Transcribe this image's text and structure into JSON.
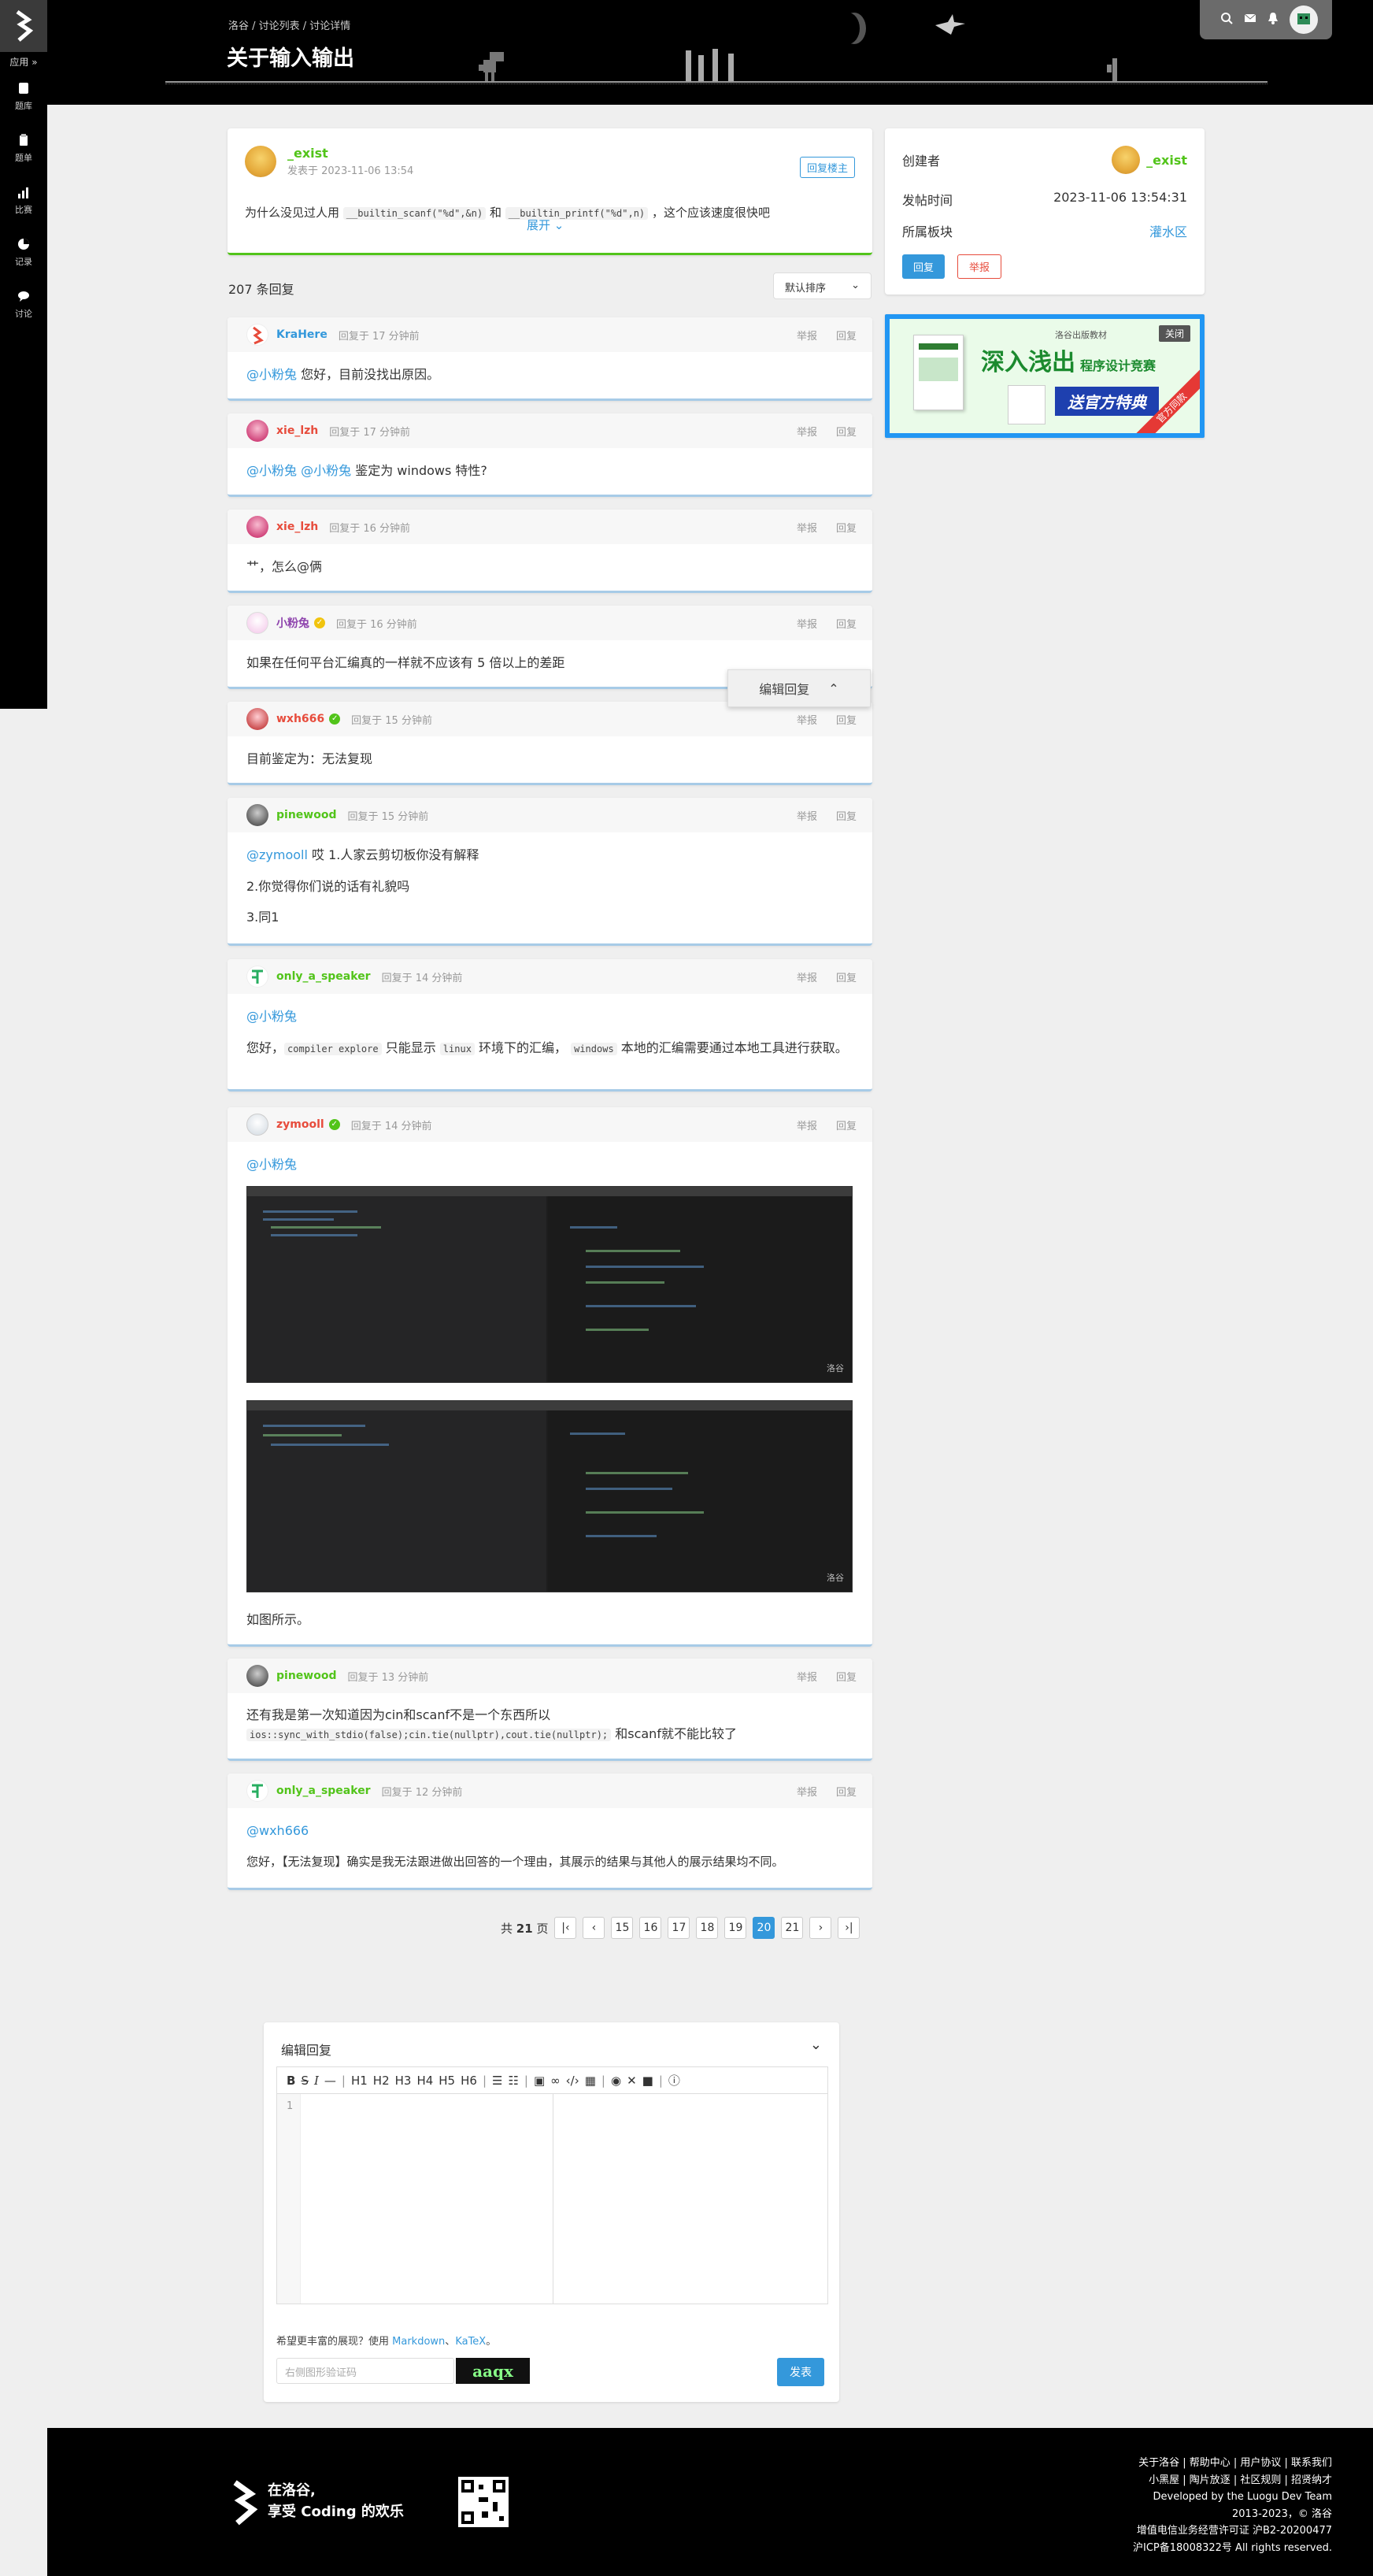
{
  "sidebar": {
    "apps_label": "应用 »",
    "nav": [
      {
        "icon": "book-icon",
        "label": "题库"
      },
      {
        "icon": "clipboard-icon",
        "label": "题单"
      },
      {
        "icon": "bar-chart-icon",
        "label": "比赛"
      },
      {
        "icon": "pie-chart-icon",
        "label": "记录"
      },
      {
        "icon": "chat-icon",
        "label": "讨论"
      }
    ]
  },
  "header": {
    "breadcrumb": "洛谷 / 讨论列表 / 讨论详情",
    "title": "关于输入输出"
  },
  "post": {
    "author": "_exist",
    "time": "发表于 2023-11-06 13:54",
    "reply_owner_label": "回复楼主",
    "content_pre": "为什么没见过人用",
    "code1": "__builtin_scanf(\"%d\",&n)",
    "content_mid": "和",
    "code2": "__builtin_printf(\"%d\",n)",
    "content_post": "，这个应该速度很快吧",
    "expand_label": "展开"
  },
  "info": {
    "creator_label": "创建者",
    "creator": "_exist",
    "time_label": "发帖时间",
    "time": "2023-11-06 13:54:31",
    "board_label": "所属板块",
    "board": "灌水区",
    "reply_btn": "回复",
    "report_btn": "举报"
  },
  "ad": {
    "close": "关闭",
    "publisher": "洛谷出版教材",
    "headline": "深入浅出",
    "headline2": "程序设计竞赛",
    "promo": "送官方特典",
    "corner": "官方同款"
  },
  "list": {
    "count": "207 条回复",
    "sort": "默认排序",
    "report": "举报",
    "reply": "回复"
  },
  "replies": [
    {
      "name": "KraHere",
      "color": "#3498db",
      "time": "回复于 17 分钟前",
      "at": "@小粉兔",
      "text": " 您好，目前没找出原因。"
    },
    {
      "name": "xie_lzh",
      "color": "#e74c3c",
      "time": "回复于 17 分钟前",
      "at": "@小粉兔",
      "at2": "@小粉兔",
      "text": " 鉴定为 windows 特性?"
    },
    {
      "name": "xie_lzh",
      "color": "#e74c3c",
      "time": "回复于 16 分钟前",
      "text": "艹，怎么@俩"
    },
    {
      "name": "小粉兔",
      "color": "#8e44ad",
      "time": "回复于 16 分钟前",
      "text": "如果在任何平台汇编真的一样就不应该有 5 倍以上的差距"
    },
    {
      "name": "wxh666",
      "color": "#e74c3c",
      "time": "回复于 15 分钟前",
      "text": "目前鉴定为：无法复现"
    },
    {
      "name": "pinewood",
      "color": "#52c41a",
      "time": "回复于 15 分钟前",
      "at": "@zymooll",
      "text": " 哎 1.人家云剪切板你没有解释",
      "line2": "2.你觉得你们说的话有礼貌吗",
      "line3": "3.同1"
    },
    {
      "name": "only_a_speaker",
      "color": "#52c41a",
      "time": "回复于 14 分钟前",
      "at": "@小粉兔",
      "pre": "您好，",
      "code_a": "compiler explore",
      "mid1": " 只能显示 ",
      "code_b": "linux",
      "mid2": " 环境下的汇编， ",
      "code_c": "windows",
      "post": " 本地的汇编需要通过本地工具进行获取。"
    },
    {
      "name": "zymooll",
      "color": "#e74c3c",
      "time": "回复于 14 分钟前",
      "at": "@小粉兔",
      "watermark": "洛谷",
      "caption": "如图所示。"
    },
    {
      "name": "pinewood",
      "color": "#52c41a",
      "time": "回复于 13 分钟前",
      "text": "还有我是第一次知道因为cin和scanf不是一个东西所以",
      "code": "ios::sync_with_stdio(false);cin.tie(nullptr),cout.tie(nullptr);",
      "tail": " 和scanf就不能比较了"
    },
    {
      "name": "only_a_speaker",
      "color": "#52c41a",
      "time": "回复于 12 分钟前",
      "at": "@wxh666",
      "text": "您好，【无法复现】确实是我无法跟进做出回答的一个理由，其展示的结果与其他人的展示结果均不同。"
    }
  ],
  "float_edit": "编辑回复",
  "pager": {
    "total_pre": "共",
    "total": "21",
    "total_post": "页",
    "pages": [
      "15",
      "16",
      "17",
      "18",
      "19",
      "20",
      "21"
    ],
    "current": "20"
  },
  "editor": {
    "title": "编辑回复",
    "toolbar": [
      "B",
      "S",
      "I",
      "—",
      "|",
      "H1",
      "H2",
      "H3",
      "H4",
      "H5",
      "H6",
      "|"
    ],
    "line_no": "1",
    "hint_pre": "希望更丰富的展现？使用",
    "hint_md": "Markdown",
    "hint_sep": "、",
    "hint_katex": "KaTeX",
    "hint_end": "。",
    "captcha_placeholder": "右侧图形验证码",
    "captcha_text": "aaqx",
    "submit": "发表"
  },
  "footer": {
    "slogan1": "在洛谷,",
    "slogan2": "享受 Coding 的欢乐",
    "links1": "关于洛谷 | 帮助中心 | 用户协议 | 联系我们",
    "links2": "小黑屋 | 陶片放逐 | 社区规则 | 招贤纳才",
    "dev": "Developed by the Luogu Dev Team",
    "copy": "2013-2023，© 洛谷",
    "license": "增值电信业务经营许可证 沪B2-20200477",
    "icp": "沪ICP备18008322号 All rights reserved."
  }
}
